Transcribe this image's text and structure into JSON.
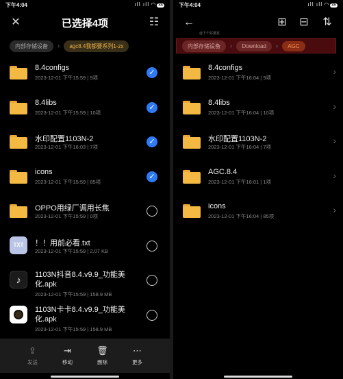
{
  "left": {
    "status": {
      "time": "下午4:04",
      "signal": "ıIl ıIl",
      "battery": "85"
    },
    "title": "已选择4项",
    "close_icon": "✕",
    "select_all_icon": "☷",
    "breadcrumbs": [
      "内部存储设备",
      "agc8.4我都要系列1-zx"
    ],
    "items": [
      {
        "name": "8.4configs",
        "meta": "2023-12-01 下午15:59 | 9项",
        "selected": true,
        "type": "folder"
      },
      {
        "name": "8.4libs",
        "meta": "2023-12-01 下午15:59 | 10项",
        "selected": true,
        "type": "folder"
      },
      {
        "name": "水印配置1103N-2",
        "meta": "2023-12-01 下午16:03 | 7项",
        "selected": true,
        "type": "folder"
      },
      {
        "name": "icons",
        "meta": "2023-12-01 下午15:59 | 85项",
        "selected": true,
        "type": "folder"
      },
      {
        "name": "OPPO用绿厂调用长焦",
        "meta": "2023-12-01 下午15:59 | 0项",
        "selected": false,
        "type": "folder"
      },
      {
        "name": "！！用前必看.txt",
        "meta": "2023-12-01 下午15:59 | 2.07 KB",
        "selected": false,
        "type": "txt",
        "icon_text": "TXT"
      },
      {
        "name": "1103N抖音8.4.v9.9_功能美化.apk",
        "meta": "2023-12-01 下午15:59 | 158.9 MB",
        "selected": false,
        "type": "tiktok",
        "icon_text": "♪"
      },
      {
        "name": "1103N卡卡8.4.v9.9_功能美化.apk",
        "meta": "2023-12-01 下午15:59 | 158.9 MB",
        "selected": false,
        "type": "kaka"
      }
    ],
    "actions": [
      {
        "icon": "⇪",
        "label": "发送",
        "dim": true
      },
      {
        "icon": "⇥",
        "label": "移动",
        "dim": false
      },
      {
        "icon": "🗑",
        "label": "删除",
        "dim": false
      },
      {
        "icon": "⋯",
        "label": "更多",
        "dim": false
      }
    ]
  },
  "right": {
    "status": {
      "time": "下午4:04",
      "signal": "ıIl ıIl",
      "battery": "85"
    },
    "back_icon": "←",
    "watermark": "@下个好朋友",
    "toolbar_icons": [
      "⊞",
      "⊟",
      "⇅"
    ],
    "breadcrumbs": [
      "内部存储设备",
      "Download",
      "AGC"
    ],
    "items": [
      {
        "name": "8.4configs",
        "meta": "2023-12-01 下午16:04 | 9项"
      },
      {
        "name": "8.4libs",
        "meta": "2023-12-01 下午16:04 | 10项"
      },
      {
        "name": "水印配置1103N-2",
        "meta": "2023-12-01 下午16:04 | 7项"
      },
      {
        "name": "AGC.8.4",
        "meta": "2023-12-01 下午16:01 | 1项"
      },
      {
        "name": "icons",
        "meta": "2023-12-01 下午16:04 | 85项"
      }
    ]
  }
}
